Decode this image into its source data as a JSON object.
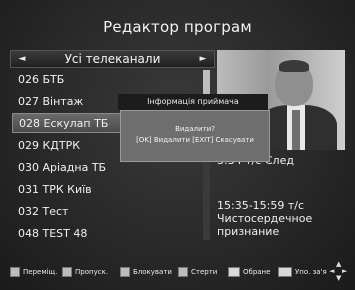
{
  "title": "Редактор програм",
  "list": {
    "header": "Усі телеканали",
    "left_arrow": "◄",
    "right_arrow": "►",
    "channels": [
      {
        "label": "026 БТБ"
      },
      {
        "label": "027 Вінтаж"
      },
      {
        "label": "028 Ескулап ТБ"
      },
      {
        "label": "029 КДТРК"
      },
      {
        "label": "030 Аріадна ТБ"
      },
      {
        "label": "031 ТРК Київ"
      },
      {
        "label": "032 Тест"
      },
      {
        "label": "048 TEST 48"
      }
    ],
    "selected_index": 2
  },
  "info": {
    "line1": "3:34  т/с След",
    "line2": "15:35-15:59  т/с",
    "line3": "Чистосердечное",
    "line4": "признание"
  },
  "dialog": {
    "title": "Інформація приймача",
    "question": "Видалити?",
    "hint": "[OK] Видалити [EXIT] Скасувати"
  },
  "footer": {
    "buttons": [
      {
        "label": "Переміщ."
      },
      {
        "label": "Пропуск."
      },
      {
        "label": "Блокувати"
      },
      {
        "label": "Стерти"
      },
      {
        "label": "Обране"
      },
      {
        "label": "Упо. за'я"
      }
    ]
  }
}
